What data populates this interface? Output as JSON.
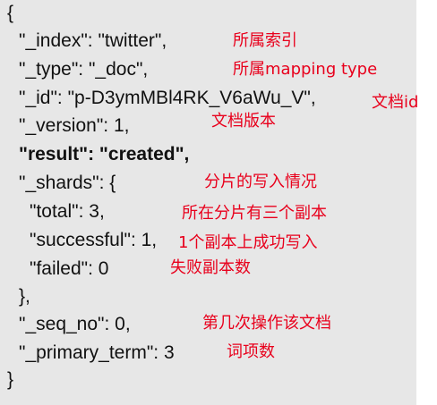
{
  "json_lines": [
    "{",
    "\"_index\": \"twitter\",",
    "\"_type\": \"_doc\",",
    "\"_id\": \"p-D3ymMBl4RK_V6aWu_V\",",
    "\"_version\": 1,",
    "\"result\": \"created\",",
    "\"_shards\": {",
    "\"total\": 3,",
    "\"successful\": 1,",
    "\"failed\": 0",
    "},",
    "\"_seq_no\": 0,",
    "\"_primary_term\": 3",
    "}"
  ],
  "annotations": {
    "index": "所属索引",
    "type": "所属mapping type",
    "id": "文档id",
    "version": "文档版本",
    "shards": "分片的写入情况",
    "total": "所在分片有三个副本",
    "successful": "1个副本上成功写入",
    "failed": "失败副本数",
    "seq_no": "第几次操作该文档",
    "primary_term": "词项数"
  },
  "colors": {
    "panel_background": "#e7e7e7",
    "code_text": "#111111",
    "annotation_text": "#e8001c"
  }
}
